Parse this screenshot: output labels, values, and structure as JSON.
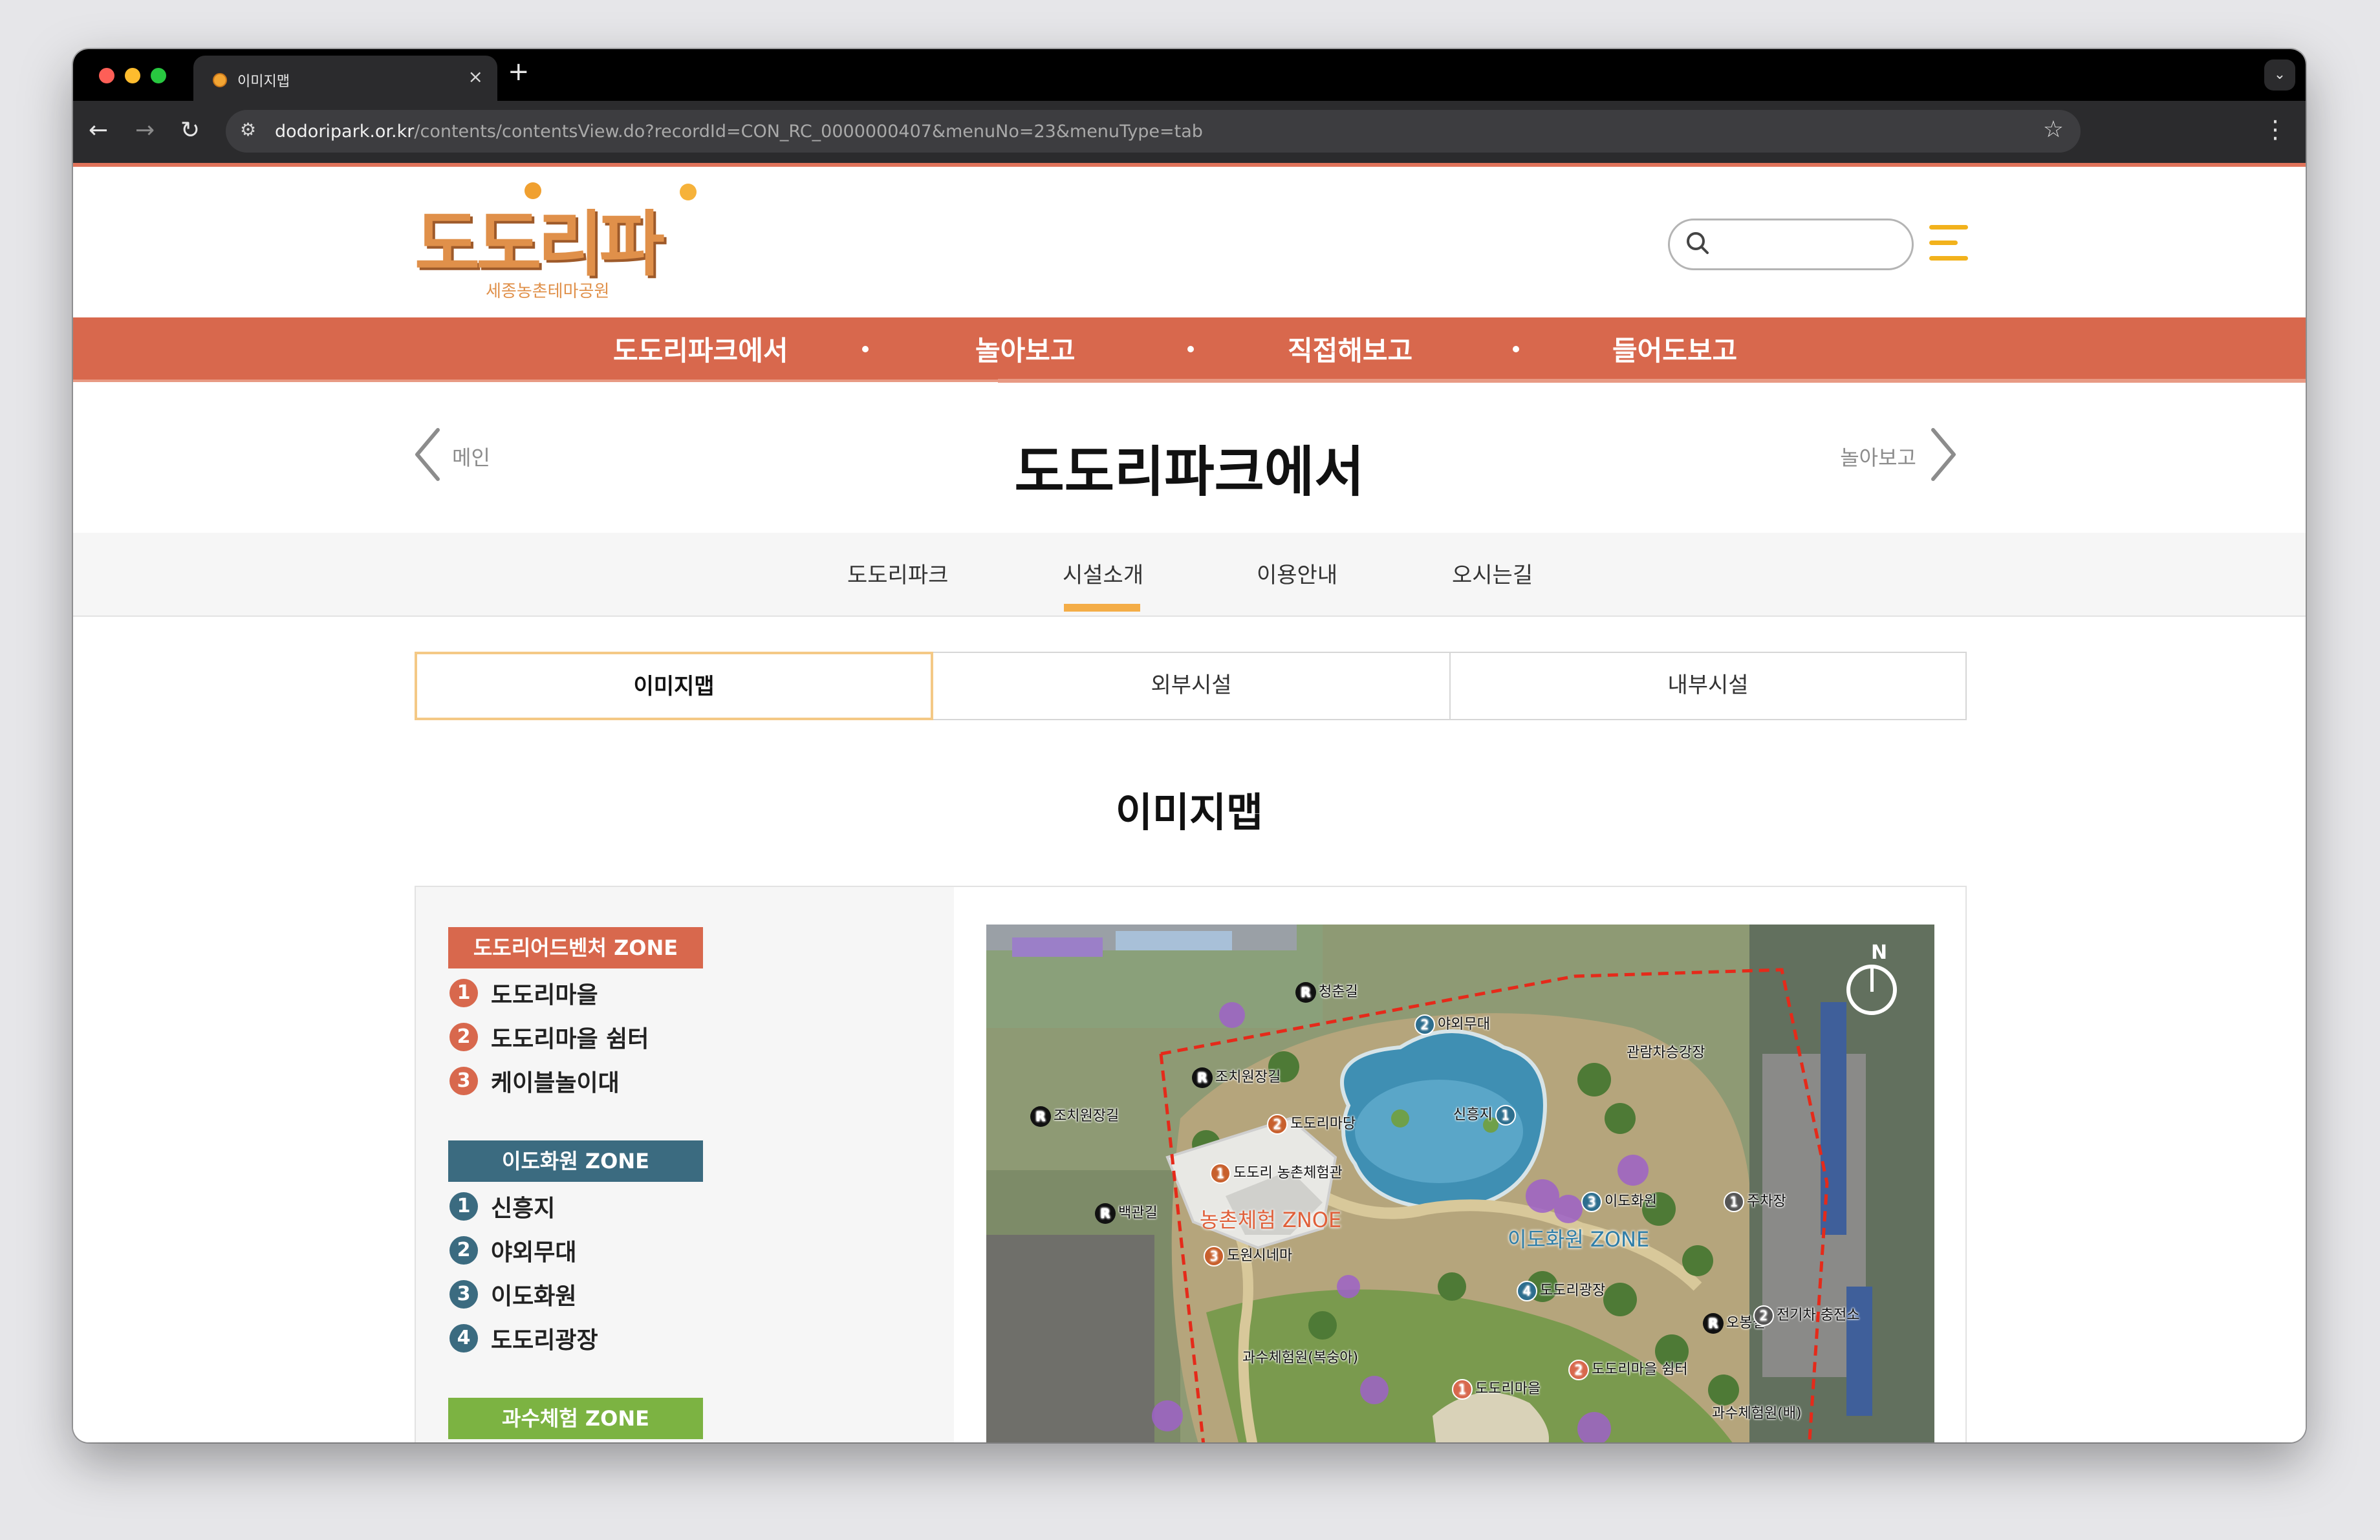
{
  "browser": {
    "tab_title": "이미지맵",
    "tab_close": "×",
    "new_tab": "+",
    "tab_menu": "⌄",
    "back": "←",
    "forward": "→",
    "reload": "↻",
    "site_info": "⚙",
    "url_host": "dodoripark.or.kr",
    "url_path": "/contents/contentsView.do?recordId=CON_RC_0000000407&menuNo=23&menuType=tab",
    "bookmark": "☆",
    "menu": "⋮"
  },
  "header": {
    "logo_text": "도도리파크",
    "logo_sub": "세종농촌테마공원"
  },
  "gnb": {
    "items": [
      "도도리파크에서",
      "놀아보고",
      "직접해보고",
      "들어도보고"
    ]
  },
  "subhead": {
    "prev": "메인",
    "title": "도도리파크에서",
    "next": "놀아보고"
  },
  "lnb": {
    "items": [
      "도도리파크",
      "시설소개",
      "이용안내",
      "오시는길"
    ],
    "active_index": 1
  },
  "content_tabs": {
    "items": [
      "이미지맵",
      "외부시설",
      "내부시설"
    ],
    "active_index": 0
  },
  "section_title": "이미지맵",
  "legend": {
    "zones": [
      {
        "title": "도도리어드벤처 ZONE",
        "color": "#d8684d",
        "items": [
          "도도리마을",
          "도도리마을 쉼터",
          "케이블놀이대"
        ]
      },
      {
        "title": "이도화원 ZONE",
        "color": "#3b6b80",
        "items": [
          "신흥지",
          "야외무대",
          "이도화원",
          "도도리광장"
        ]
      },
      {
        "title": "과수체험 ZONE",
        "color": "#7cb342",
        "items": []
      }
    ]
  },
  "map": {
    "north": "N",
    "road_mark": "R",
    "roads": [
      "청춘길",
      "조치원장길",
      "조치원장길",
      "백관길",
      "오봉길"
    ],
    "numbered": [
      {
        "num": "2",
        "label": "야외무대",
        "color": "#2d6e8e"
      },
      {
        "num": "2",
        "label": "도도리마당",
        "color": "#c8602d"
      },
      {
        "num": "1",
        "label": "도도리 농촌체험관",
        "color": "#c8602d"
      },
      {
        "num": "3",
        "label": "도원시네마",
        "color": "#c8602d"
      },
      {
        "num": "1",
        "label": "신흥지",
        "color": "#2d6e8e"
      },
      {
        "num": "3",
        "label": "이도화원",
        "color": "#2d6e8e"
      },
      {
        "num": "4",
        "label": "도도리광장",
        "color": "#2d6e8e"
      },
      {
        "num": "1",
        "label": "주차장",
        "color": "#555555"
      },
      {
        "num": "2",
        "label": "전기차 충전소",
        "color": "#555555"
      },
      {
        "num": "1",
        "label": "도도리마을",
        "color": "#d8684d"
      },
      {
        "num": "2",
        "label": "도도리마을 쉼터",
        "color": "#d8684d"
      }
    ],
    "plain": [
      "관람차승강장",
      "과수체험원(복숭아)",
      "과수체험원(배)"
    ],
    "zones": [
      {
        "label": "농촌체험 ZNOE",
        "color": "#e0603a"
      },
      {
        "label": "이도화원 ZONE",
        "color": "#2f7ea8"
      }
    ]
  },
  "colors": {
    "brand": "#d8684d",
    "accent": "#f4ad47",
    "hamburger": "#f2b21c"
  }
}
